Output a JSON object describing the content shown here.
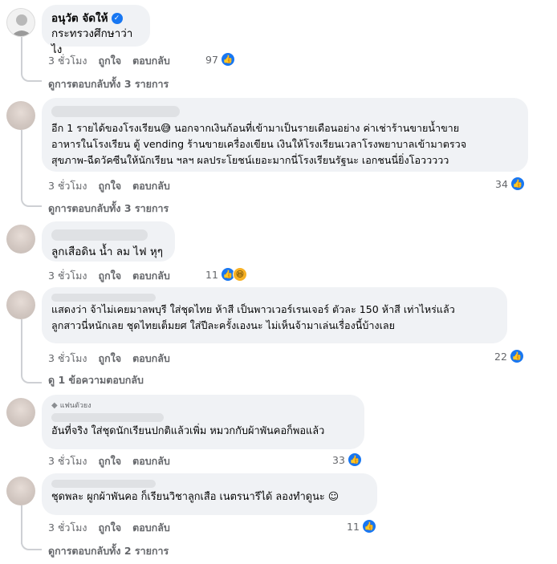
{
  "comments": [
    {
      "author": "อนุวัต จัดให้",
      "verified": true,
      "text": "กระทรวงศึกษาว่าไง",
      "time": "3 ชั่วโมง",
      "like_label": "ถูกใจ",
      "reply_label": "ตอบกลับ",
      "reaction_count": "97",
      "reactions": [
        "like-icon"
      ],
      "view_replies": "ดูการตอบกลับทั้ง 3 รายการ"
    },
    {
      "text": "อีก 1 รายได้ของโรงเรียน😅 นอกจากเงินก้อนที่เข้ามาเป็นรายเดือนอย่าง ค่าเช่าร้านขายน้ำขาย\nอาหารในโรงเรียน ตู้ vending ร้านขายเครื่องเขียน เงินให้โรงเรียนเวลาโรงพยาบาลเข้ามาตรวจ\nสุขภาพ-ฉีดวัคซีนให้นักเรียน ฯลฯ ผลประโยชน์เยอะมากนี่โรงเรียนรัฐนะ เอกชนนี่ยิ่งโอววววว",
      "time": "3 ชั่วโมง",
      "like_label": "ถูกใจ",
      "reply_label": "ตอบกลับ",
      "reaction_count": "34",
      "reactions": [
        "like-icon"
      ],
      "view_replies": "ดูการตอบกลับทั้ง 3 รายการ"
    },
    {
      "text": "ลูกเสือดิน น้ำ ลม ไฟ หุๆ",
      "time": "3 ชั่วโมง",
      "like_label": "ถูกใจ",
      "reply_label": "ตอบกลับ",
      "reaction_count": "11",
      "reactions": [
        "like-icon",
        "haha-icon"
      ]
    },
    {
      "text": "แสดงว่า จ้าไม่เคยมาลพบุรี ใส่ชุดไทย ห้าสี เป็นพาวเวอร์เรนเจอร์ ตัวละ 150 ห้าสี เท่าไหร่แล้ว\nลูกสาวนี่หนักเลย ชุดไทยเต็มยศ ใส่ปีละครั้งเองนะ ไม่เห็นจ้ามาเล่นเรื่องนี้บ้างเลย",
      "time": "3 ชั่วโมง",
      "like_label": "ถูกใจ",
      "reply_label": "ตอบกลับ",
      "reaction_count": "22",
      "reactions": [
        "like-icon"
      ],
      "view_replies": "ดู 1 ข้อความตอบกลับ"
    },
    {
      "badge": "แฟนตัวยง",
      "text": "อันที่จริง ใส่ชุดนักเรียนปกติแล้วเพิ่ม หมวกกับผ้าพันคอก็พอแล้ว",
      "time": "3 ชั่วโมง",
      "like_label": "ถูกใจ",
      "reply_label": "ตอบกลับ",
      "reaction_count": "33",
      "reactions": [
        "like-icon"
      ]
    },
    {
      "text": "ชุดพละ ผูกผ้าพันคอ ก็เรียนวิชาลูกเสือ เนตรนารีได้ ลองทำดูนะ ☺",
      "time": "3 ชั่วโมง",
      "like_label": "ถูกใจ",
      "reply_label": "ตอบกลับ",
      "reaction_count": "11",
      "reactions": [
        "like-icon"
      ],
      "view_replies": "ดูการตอบกลับทั้ง 2 รายการ"
    }
  ],
  "colors": {
    "bubble": "#f0f2f5",
    "secondary_text": "#65676b",
    "like_blue": "#1877f2",
    "thread_line": "#ced0d4"
  }
}
